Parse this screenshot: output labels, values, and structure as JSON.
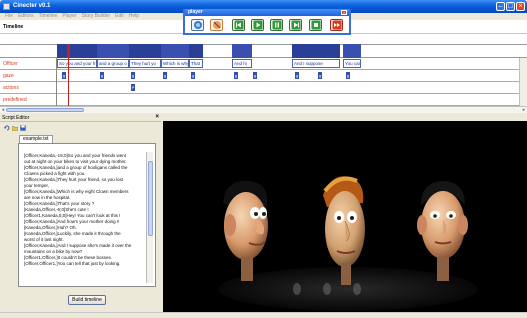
{
  "app": {
    "title": "Cinecter  v0.1"
  },
  "window_controls": {
    "minimize": "–",
    "maximize": "□",
    "close": "×"
  },
  "menu": [
    "File",
    "Editors",
    "Timeline",
    "Player",
    "Story Builder",
    "Edit",
    "Help"
  ],
  "timeline": {
    "header": "Timeline",
    "tracks": [
      {
        "label": "Officer",
        "clips": [
          "So you and your fri",
          "and a group o",
          "They hurt yo",
          "Which is why",
          "That",
          "And hi",
          "And I suppose",
          "You car"
        ]
      },
      {
        "label": "gaze",
        "markers": [
          "g",
          "g",
          "g",
          "g",
          "g",
          "g",
          "g",
          "g",
          "g",
          "g"
        ]
      },
      {
        "label": "actions",
        "markers": [
          "P"
        ]
      },
      {
        "label": "predefined",
        "markers": []
      }
    ]
  },
  "script_editor": {
    "title": "Script Editor",
    "close": "×",
    "tab": "example.txt",
    "lines": [
      "[Officer,Kaneda,-15;0]So you and your friends went",
      "out at night on your bikes to visit your dying mother,",
      "[Officer,Kaneda,]and a group of hooligans called the",
      "Clowns picked a fight with you.",
      "[Officer,Kaneda,]They hurt your friend, so you lost",
      "your temper,",
      "[Officer,Kaneda,]Which is why eight Clown members",
      "are now in the hospital.",
      "[Officer,Kaneda,]That's your story ?",
      "[Kaneda,Officer,-6;0]She's cute !",
      "[Officer1,Kaneda,5;0]Hey! You can't look at this !",
      "[Officer,Kaneda,]And how's your mother doing !!",
      "[Kaneda,Officer,]Huh? Oh.",
      "[Kaneda,Officer,]Luckily, she made it through the",
      "worst of it last night.",
      "[Officer,Kaneda,]And I suppose she's made it over the",
      "mountains on a bike by now?",
      "[Officer1,Officer,]It couldn't be these bosses.",
      "[Officer,Officer1,]You can tell that just by looking."
    ],
    "build_button": "Build timeline"
  },
  "player": {
    "title": "player",
    "close": "×",
    "buttons": [
      "record",
      "stop-record",
      "rewind",
      "play",
      "pause",
      "fast-forward",
      "stop",
      "exit"
    ]
  },
  "colors": {
    "accent": "#0a5fd8",
    "timeline_clip_border": "#4b63b8",
    "track_label": "#d04020",
    "stage_bg": "#000000"
  }
}
